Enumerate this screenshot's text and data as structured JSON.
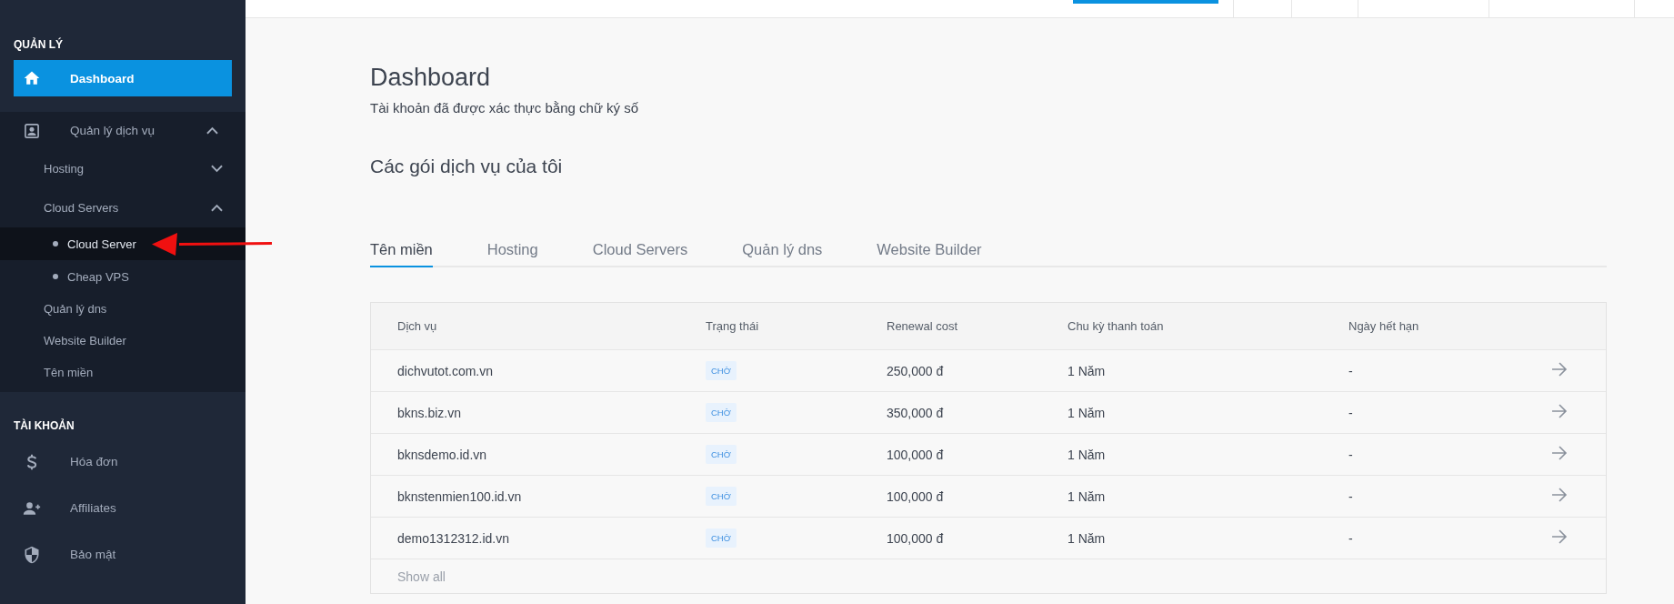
{
  "sidebar": {
    "sections": [
      {
        "title": "QUẢN LÝ",
        "items": [
          {
            "label": "Dashboard",
            "selected": true
          },
          {
            "label": "Quản lý dịch vụ",
            "selected": false,
            "expanded": true,
            "children": [
              {
                "label": "Hosting",
                "selected": false,
                "expanded": false
              },
              {
                "label": "Cloud Servers",
                "selected": false,
                "expanded": true,
                "children": [
                  {
                    "label": "Cloud Server",
                    "selected": true
                  },
                  {
                    "label": "Cheap VPS",
                    "selected": false
                  }
                ]
              },
              {
                "label": "Quản lý dns",
                "selected": false
              },
              {
                "label": "Website Builder",
                "selected": false
              },
              {
                "label": "Tên miền",
                "selected": false
              }
            ]
          }
        ]
      },
      {
        "title": "TÀI KHOẢN",
        "items": [
          {
            "label": "Hóa đơn",
            "selected": false
          },
          {
            "label": "Affiliates",
            "selected": false
          },
          {
            "label": "Bảo mật",
            "selected": false
          }
        ]
      }
    ]
  },
  "page": {
    "title": "Dashboard",
    "subtitle": "Tài khoản đã được xác thực bằng chữ ký số",
    "section_title": "Các gói dịch vụ của tôi"
  },
  "tabs": [
    {
      "label": "Tên miền",
      "selected": true
    },
    {
      "label": "Hosting",
      "selected": false
    },
    {
      "label": "Cloud Servers",
      "selected": false
    },
    {
      "label": "Quản lý dns",
      "selected": false
    },
    {
      "label": "Website Builder",
      "selected": false
    }
  ],
  "table": {
    "columns": [
      "Dịch vụ",
      "Trạng thái",
      "Renewal cost",
      "Chu kỳ thanh toán",
      "Ngày hết hạn"
    ],
    "rows": [
      {
        "service": "dichvutot.com.vn",
        "status": "CHỜ",
        "cost": "250,000 đ",
        "cycle": "1 Năm",
        "expiry": "-"
      },
      {
        "service": "bkns.biz.vn",
        "status": "CHỜ",
        "cost": "350,000 đ",
        "cycle": "1 Năm",
        "expiry": "-"
      },
      {
        "service": "bknsdemo.id.vn",
        "status": "CHỜ",
        "cost": "100,000 đ",
        "cycle": "1 Năm",
        "expiry": "-"
      },
      {
        "service": "bknstenmien100.id.vn",
        "status": "CHỜ",
        "cost": "100,000 đ",
        "cycle": "1 Năm",
        "expiry": "-"
      },
      {
        "service": "demo1312312.id.vn",
        "status": "CHỜ",
        "cost": "100,000 đ",
        "cycle": "1 Năm",
        "expiry": "-"
      }
    ],
    "footer_link": "Show all"
  }
}
